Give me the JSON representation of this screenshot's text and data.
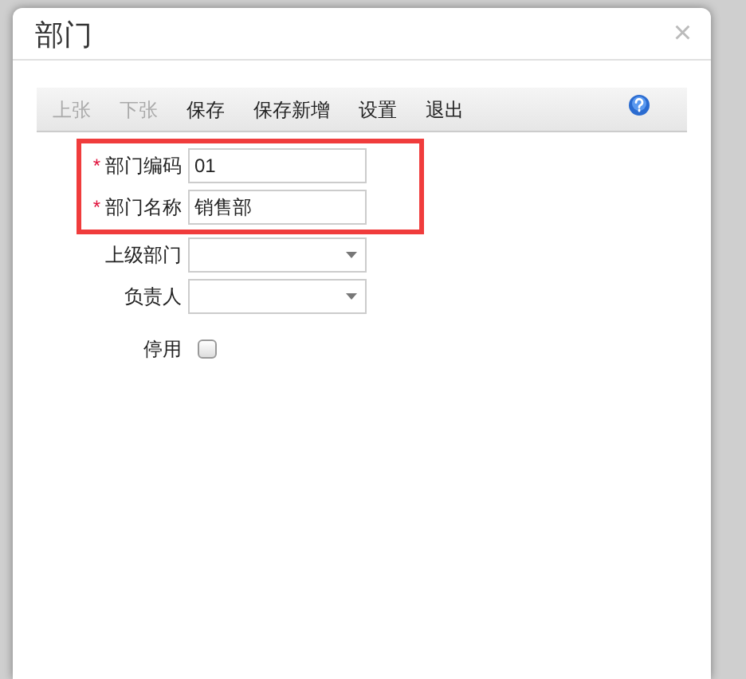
{
  "window": {
    "title": "部门",
    "close": "×"
  },
  "toolbar": [
    {
      "label": "上张",
      "disabled": true
    },
    {
      "label": "下张",
      "disabled": true
    },
    {
      "label": "保存",
      "disabled": false
    },
    {
      "label": "保存新增",
      "disabled": false
    },
    {
      "label": "设置",
      "disabled": false
    },
    {
      "label": "退出",
      "disabled": false
    }
  ],
  "fields": [
    {
      "kind": "text",
      "required_mark": "*",
      "label": "部门编码",
      "highlighted": true,
      "value": "01"
    },
    {
      "kind": "text",
      "required_mark": "*",
      "label": "部门名称",
      "highlighted": true,
      "value": "销售部"
    },
    {
      "kind": "select",
      "label": "上级部门",
      "highlighted": false
    },
    {
      "kind": "select",
      "label": "负责人",
      "highlighted": false
    },
    {
      "kind": "checkbox",
      "label": "停用",
      "highlighted": false,
      "checked": false
    }
  ]
}
